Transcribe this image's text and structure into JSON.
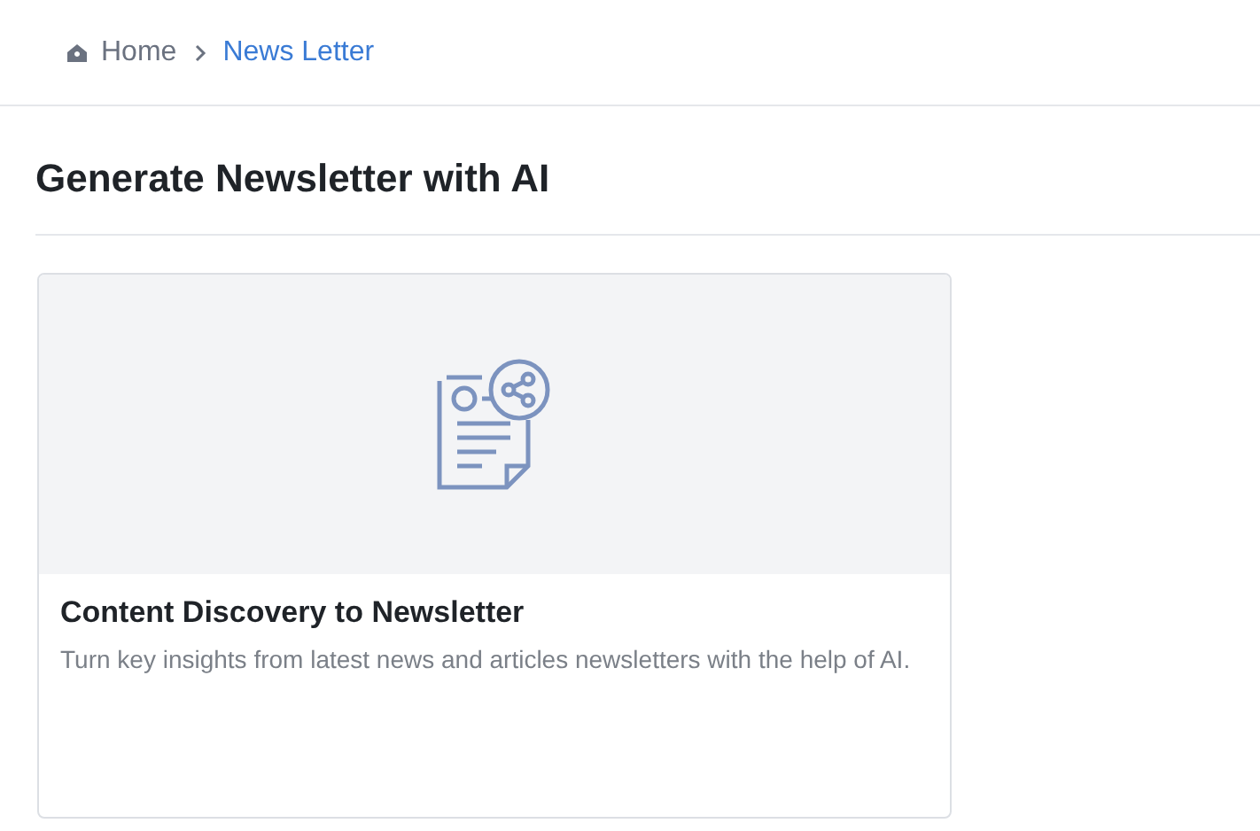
{
  "breadcrumbs": [
    {
      "label": "Home",
      "current": false
    },
    {
      "label": "News Letter",
      "current": true
    }
  ],
  "title": "Generate Newsletter with AI",
  "cards": [
    {
      "title": "Content Discovery to Newsletter",
      "description": "Turn key insights from latest news and articles newsletters with the help of AI."
    }
  ]
}
